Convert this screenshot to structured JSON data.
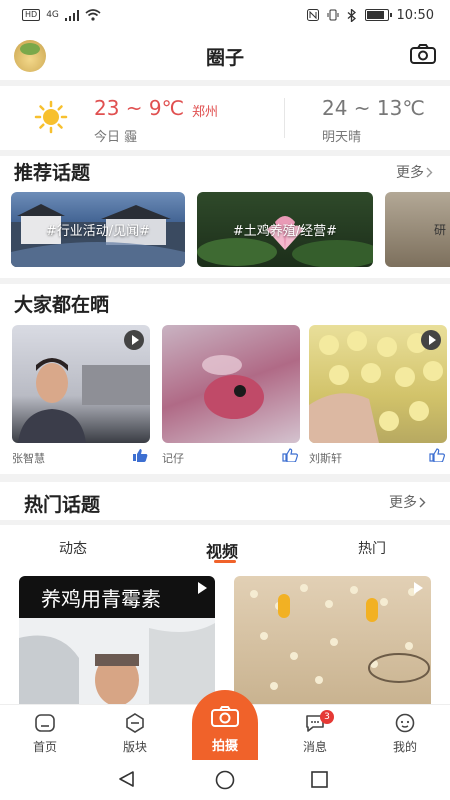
{
  "status_bar": {
    "signal": "4G",
    "hd": "HD",
    "time": "10:50",
    "battery_level": 0.9
  },
  "header": {
    "title": "圈子",
    "avatar_icon": "chick-avatar-icon",
    "camera_icon": "camera-icon"
  },
  "weather": {
    "today_temp": "23 ~ 9℃",
    "city": "郑州",
    "today_label": "今日 霾",
    "tomorrow_temp": "24 ~ 13℃",
    "tomorrow_label": "明天晴"
  },
  "recommended": {
    "title": "推荐话题",
    "more": "更多",
    "topics": [
      {
        "label": "#行业活动/见闻#"
      },
      {
        "label": "#土鸡养殖/经营#"
      },
      {
        "label": "研"
      }
    ]
  },
  "showing": {
    "title": "大家都在晒",
    "posts": [
      {
        "user": "张智慧",
        "liked": true
      },
      {
        "user": "记仔",
        "liked": false
      },
      {
        "user": "刘斯轩",
        "liked": false
      }
    ]
  },
  "hot": {
    "title": "热门话题",
    "more": "更多",
    "tabs": [
      "动态",
      "视频",
      "热门"
    ],
    "active_tab": 1,
    "videos": [
      {
        "caption": "养鸡用青霉素"
      },
      {
        "caption": ""
      }
    ]
  },
  "nav": {
    "items": [
      {
        "label": "首页",
        "icon": "home-icon"
      },
      {
        "label": "版块",
        "icon": "section-icon"
      },
      {
        "label": "拍摄",
        "icon": "camera-icon"
      },
      {
        "label": "消息",
        "icon": "message-icon",
        "badge": "3"
      },
      {
        "label": "我的",
        "icon": "profile-icon"
      }
    ]
  },
  "colors": {
    "accent": "#f0622a",
    "weather_red": "#e05050",
    "badge": "#e53935"
  }
}
